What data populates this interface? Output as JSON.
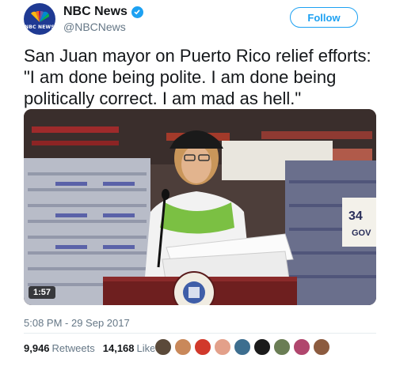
{
  "header": {
    "avatar_text": "NBC NEWS",
    "name": "NBC News",
    "handle": "@NBCNews",
    "follow_label": "Follow"
  },
  "tweet": {
    "text": "San Juan mayor on Puerto Rico relief efforts: \"I am done being polite. I am done being politically correct. I am mad as hell.\"",
    "timestamp": "5:08 PM - 29 Sep 2017"
  },
  "media": {
    "duration": "1:57",
    "sign_text": "34",
    "sign_text2": "GOV"
  },
  "stats": {
    "retweets_count": "9,946",
    "retweets_label": "Retweets",
    "likes_count": "14,168",
    "likes_label": "Likes"
  },
  "likers": [
    {
      "color": "#5b4a3a"
    },
    {
      "color": "#c9885a"
    },
    {
      "color": "#d1392b"
    },
    {
      "color": "#e3a08a"
    },
    {
      "color": "#3d6e8f"
    },
    {
      "color": "#1b1b1b"
    },
    {
      "color": "#6a7d54"
    },
    {
      "color": "#b0466d"
    },
    {
      "color": "#8c5b3f"
    }
  ],
  "colors": {
    "accent": "#1da1f2",
    "text": "#14171a",
    "secondary": "#657786"
  }
}
